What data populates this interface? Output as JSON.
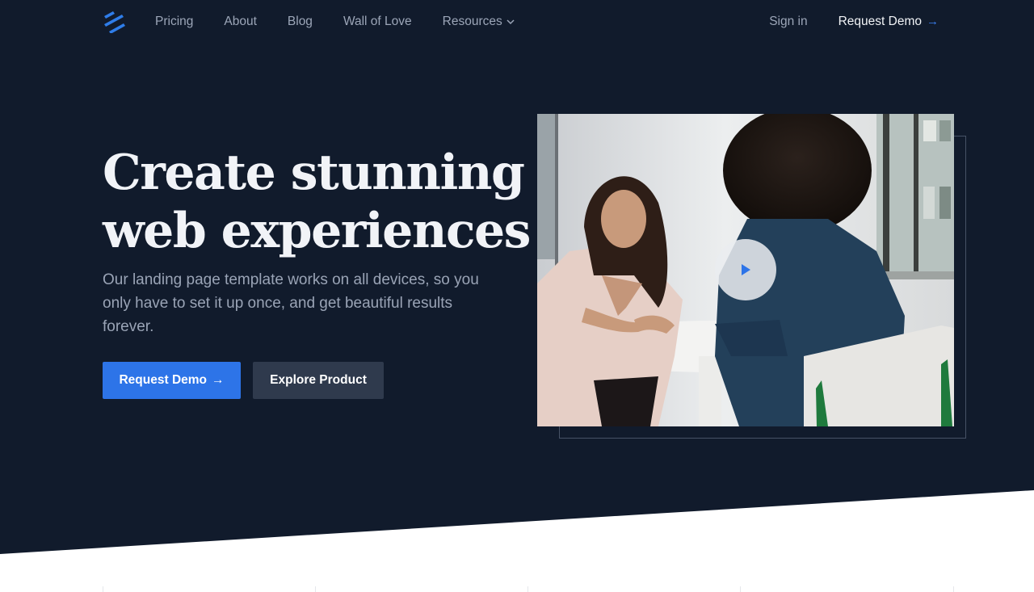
{
  "nav": {
    "links": [
      {
        "label": "Pricing"
      },
      {
        "label": "About"
      },
      {
        "label": "Blog"
      },
      {
        "label": "Wall of Love"
      },
      {
        "label": "Resources"
      }
    ],
    "sign_in": "Sign in",
    "request_demo": "Request Demo",
    "arrow": "→"
  },
  "hero": {
    "headline_line1": "Create stunning",
    "headline_line2": "web experiences",
    "subtitle": "Our landing page template works on all devices, so you only have to set it up once, and get beautiful results forever.",
    "primary_button": "Request Demo",
    "primary_arrow": "→",
    "secondary_button": "Explore Product"
  },
  "icons": {
    "logo": "stripes-logo-icon",
    "resources_dropdown": "chevron-down-icon",
    "play": "play-icon"
  },
  "colors": {
    "background": "#111b2c",
    "accent": "#2d74e8",
    "secondary_button": "#2f3a4d",
    "headline": "#f1f3f7",
    "muted_text": "#9aa4b6"
  }
}
